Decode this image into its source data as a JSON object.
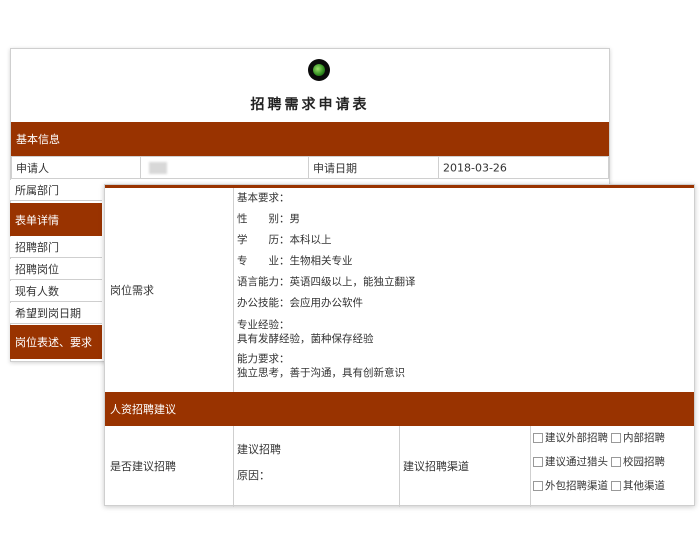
{
  "form": {
    "title": "招聘需求申请表",
    "basic_section": "基本信息",
    "applicant_label": "申请人",
    "apply_date_label": "申请日期",
    "apply_date_value": "2018-03-26",
    "dept_label": "所属部门",
    "detail_section": "表单详情",
    "side_items": [
      "招聘部门",
      "招聘岗位",
      "现有人数",
      "希望到岗日期"
    ],
    "desc_section": "岗位表述、要求"
  },
  "requirements": {
    "row_label": "岗位需求",
    "basic_title": "基本要求：",
    "gender": "性　　别：男",
    "education": "学　　历：本科以上",
    "major": "专　　业：生物相关专业",
    "language": "语言能力：英语四级以上，能独立翻译",
    "office": "办公技能：会应用办公软件",
    "exp_title": "专业经验：",
    "exp_value": "具有发酵经验，菌种保存经验",
    "ability_title": "能力要求：",
    "ability_value": "独立思考，善于沟通，具有创新意识"
  },
  "hr_section": {
    "title": "人资招聘建议",
    "suggest_label": "是否建议招聘",
    "suggest_value": "建议招聘",
    "reason_label": "原因：",
    "channel_label": "建议招聘渠道",
    "channels": [
      "建议外部招聘",
      "内部招聘",
      "建议通过猎头",
      "校园招聘",
      "外包招聘渠道",
      "其他渠道"
    ]
  },
  "colors": {
    "accent": "#993300"
  }
}
